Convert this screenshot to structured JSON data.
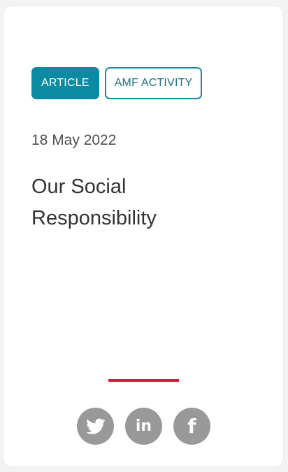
{
  "tags": {
    "primary": "ARTICLE",
    "secondary": "AMF ACTIVITY"
  },
  "date": "18 May 2022",
  "title": "Our Social Responsibility",
  "social": {
    "twitter": "twitter-icon",
    "linkedin": "in",
    "facebook": "f"
  },
  "colors": {
    "accent_teal": "#0a8aa3",
    "divider_red": "#d8193a",
    "social_gray": "#999999"
  }
}
